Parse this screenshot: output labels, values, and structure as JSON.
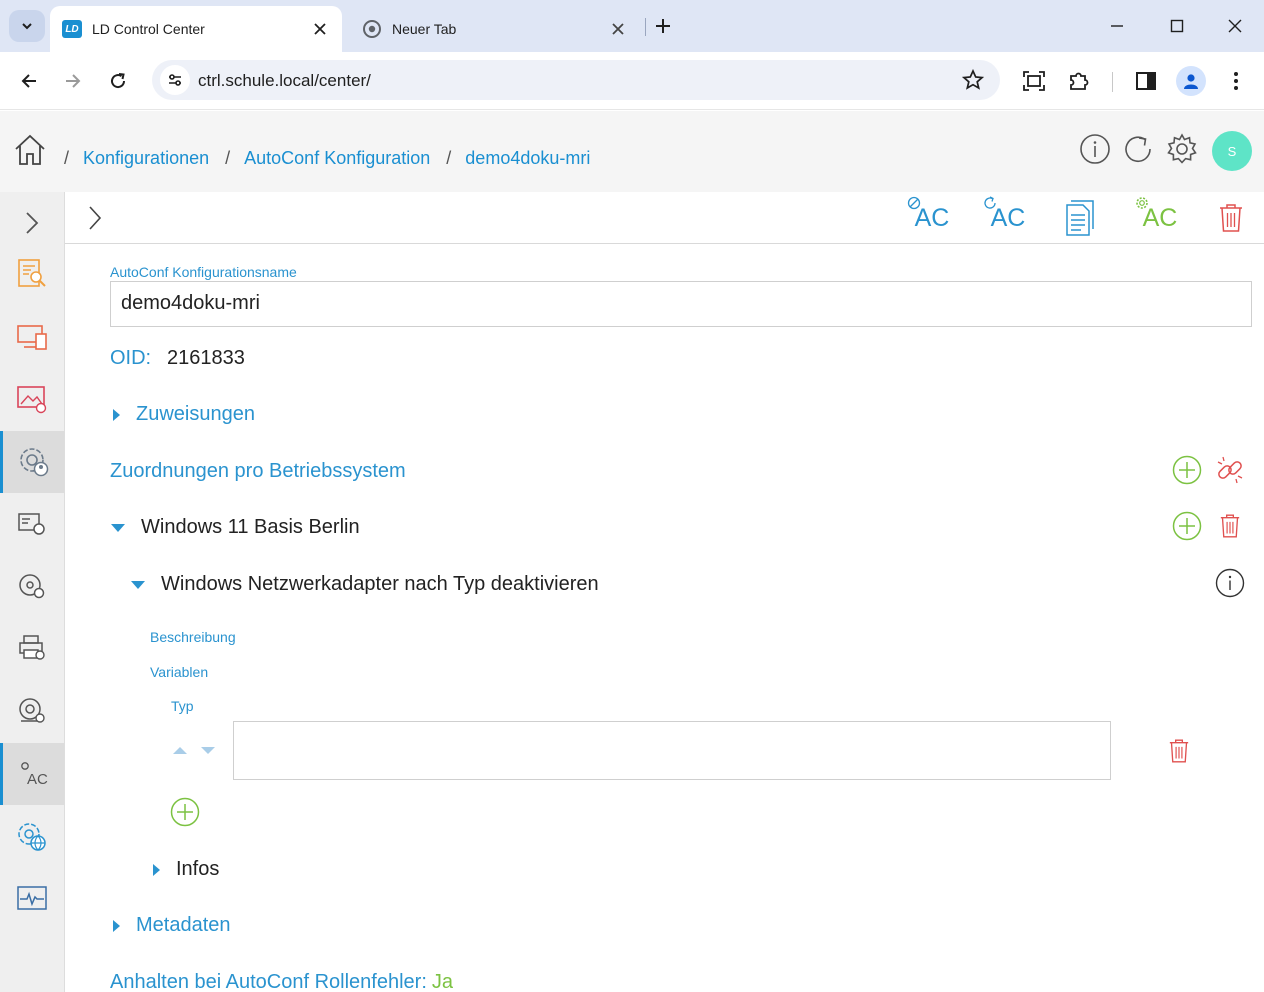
{
  "browser": {
    "tabs": [
      {
        "title": "LD Control Center",
        "favicon": "LD",
        "active": true
      },
      {
        "title": "Neuer Tab",
        "active": false
      }
    ],
    "url": "ctrl.schule.local/center/"
  },
  "header": {
    "breadcrumbs": [
      "Konfigurationen",
      "AutoConf Konfiguration",
      "demo4doku-mri"
    ],
    "separator": "/",
    "avatar_letter": "S"
  },
  "toolbar": {
    "ac_label": "AC"
  },
  "form": {
    "name_label": "AutoConf Konfigurationsname",
    "name_value": "demo4doku-mri",
    "oid_label": "OID:",
    "oid_value": "2161833",
    "zuweisungen": "Zuweisungen",
    "zuordnungen": "Zuordnungen pro Betriebssystem",
    "os_group": "Windows 11 Basis Berlin",
    "role": "Windows Netzwerkadapter nach Typ deaktivieren",
    "beschreibung": "Beschreibung",
    "variablen": "Variablen",
    "typ": "Typ",
    "typ_value": "",
    "infos": "Infos",
    "metadaten": "Metadaten",
    "anhalten_label": "Anhalten bei AutoConf Rollenfehler:",
    "anhalten_value": "Ja"
  },
  "colors": {
    "accent": "#1a8fd1",
    "green": "#7cc242",
    "red": "#e0504f",
    "avatar": "#5ee4c7"
  }
}
